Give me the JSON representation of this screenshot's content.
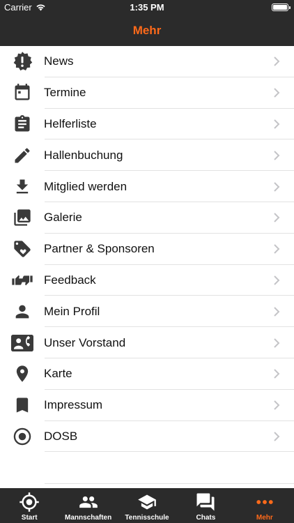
{
  "status": {
    "carrier": "Carrier",
    "time": "1:35 PM"
  },
  "nav": {
    "title": "Mehr"
  },
  "menu": [
    {
      "label": "News",
      "icon": "alert-badge-icon"
    },
    {
      "label": "Termine",
      "icon": "calendar-icon"
    },
    {
      "label": "Helferliste",
      "icon": "clipboard-icon"
    },
    {
      "label": "Hallenbuchung",
      "icon": "pencil-icon"
    },
    {
      "label": "Mitglied werden",
      "icon": "download-icon"
    },
    {
      "label": "Galerie",
      "icon": "photo-library-icon"
    },
    {
      "label": "Partner & Sponsoren",
      "icon": "heart-tag-icon"
    },
    {
      "label": "Feedback",
      "icon": "thumbs-up-down-icon"
    },
    {
      "label": "Mein Profil",
      "icon": "person-icon"
    },
    {
      "label": "Unser Vorstand",
      "icon": "contact-phone-icon"
    },
    {
      "label": "Karte",
      "icon": "map-pin-icon"
    },
    {
      "label": "Impressum",
      "icon": "bookmark-icon"
    },
    {
      "label": "DOSB",
      "icon": "radio-target-icon"
    }
  ],
  "tabs": [
    {
      "label": "Start",
      "icon": "crosshair-icon",
      "active": false
    },
    {
      "label": "Mannschaften",
      "icon": "people-icon",
      "active": false
    },
    {
      "label": "Tennisschule",
      "icon": "graduation-cap-icon",
      "active": false
    },
    {
      "label": "Chats",
      "icon": "chat-bubbles-icon",
      "active": false
    },
    {
      "label": "Mehr",
      "icon": "more-dots-icon",
      "active": true
    }
  ],
  "colors": {
    "accent": "#ff6a1a",
    "bar": "#2b2b2b",
    "icon": "#3a3a3a"
  }
}
